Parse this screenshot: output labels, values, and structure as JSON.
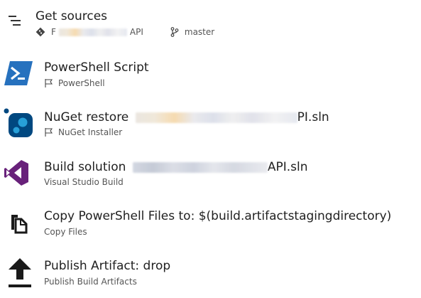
{
  "tasks": {
    "get_sources": {
      "title": "Get sources",
      "repo_prefix": "F",
      "repo_suffix": "API",
      "branch": "master",
      "icon": "get-sources-list-icon"
    },
    "powershell": {
      "title": "PowerShell Script",
      "subtitle": "PowerShell",
      "icon": "powershell-icon"
    },
    "nuget": {
      "title_prefix": "NuGet restore",
      "title_suffix": "PI.sln",
      "subtitle": "NuGet Installer",
      "icon": "nuget-icon"
    },
    "build": {
      "title_prefix": "Build solution",
      "title_suffix": "API.sln",
      "subtitle": "Visual Studio Build",
      "icon": "visual-studio-icon"
    },
    "copy": {
      "title": "Copy PowerShell Files to: $(build.artifactstagingdirectory)",
      "subtitle": "Copy Files",
      "icon": "copy-files-icon"
    },
    "publish": {
      "title": "Publish Artifact: drop",
      "subtitle": "Publish Build Artifacts",
      "icon": "upload-arrow-icon"
    }
  },
  "colors": {
    "powershell_blue": "#2671be",
    "nuget_blue": "#004880",
    "nuget_light": "#27a0d8",
    "vs_purple": "#68217a",
    "text": "#212121",
    "subtext": "#555555"
  }
}
